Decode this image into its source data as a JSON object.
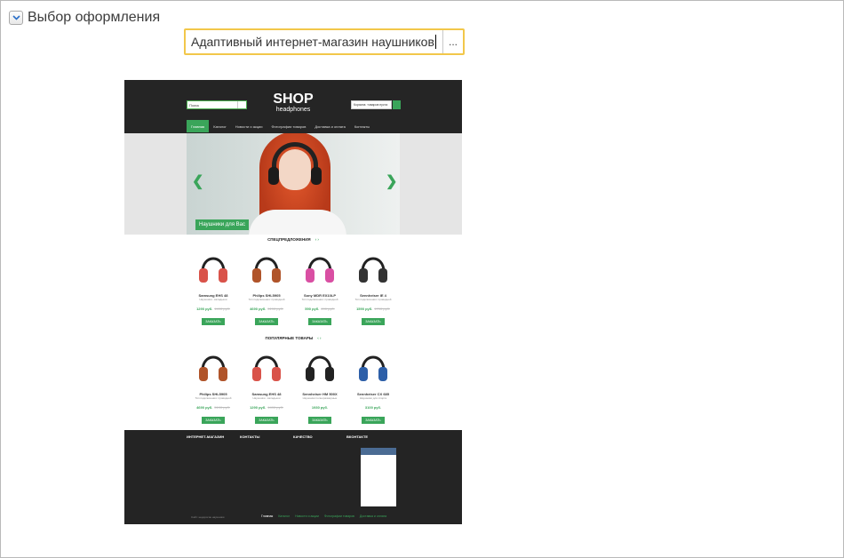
{
  "group": {
    "title": "Выбор оформления"
  },
  "field": {
    "value": "Адаптивный интернет-магазин наушников",
    "button_label": "..."
  },
  "preview": {
    "logo_line1": "SHOP",
    "logo_line2": "headphones",
    "search_placeholder": "Поиск",
    "cart_text": "Корзина: товаров пуста",
    "nav": [
      "Главная",
      "Каталог",
      "Новости и акции",
      "Фотографии товаров",
      "Доставка и оплата",
      "Контакты"
    ],
    "banner_tag": "Наушники для Вас",
    "section1_title": "СПЕЦПРЕДЛОЖЕНИЯ",
    "section2_title": "ПОПУЛЯРНЫЕ ТОВАРЫ",
    "products1": [
      {
        "name": "Samsung EHS 48",
        "desc": "Наушники - вкладыши",
        "price": "1290 руб.",
        "old": "1490 руб.",
        "buy": "ЗАКАЗАТЬ",
        "color": "#d9534a"
      },
      {
        "name": "Philips SHL5905",
        "desc": "Тип подключения: проводной",
        "price": "4690 руб.",
        "old": "5190 руб.",
        "buy": "ЗАКАЗАТЬ",
        "color": "#b0542a"
      },
      {
        "name": "Sony MDR EX10LP",
        "desc": "Тип подключения: проводной",
        "price": "590 руб.",
        "old": "690 руб.",
        "buy": "ЗАКАЗАТЬ",
        "color": "#d94fa3"
      },
      {
        "name": "Sennheiser IE 4",
        "desc": "Тип подключения: проводной",
        "price": "1590 руб.",
        "old": "1790 руб.",
        "buy": "ЗАКАЗАТЬ",
        "color": "#333333"
      }
    ],
    "products2": [
      {
        "name": "Philips SHL5905",
        "desc": "Тип подключения: проводной",
        "price": "4690 руб.",
        "old": "5190 руб.",
        "buy": "ЗАКАЗАТЬ",
        "color": "#b0542a"
      },
      {
        "name": "Samsung EHS 48",
        "desc": "Наушники - вкладыши",
        "price": "1290 руб.",
        "old": "1490 руб.",
        "buy": "ЗАКАЗАТЬ",
        "color": "#d9534a"
      },
      {
        "name": "Sennheiser HM 500X",
        "desc": "Наушники полноразмерные",
        "price": "1930 руб.",
        "old": "",
        "buy": "ЗАКАЗАТЬ",
        "color": "#222222"
      },
      {
        "name": "Sennheiser CX 685",
        "desc": "Наушники для спорта",
        "price": "3100 руб.",
        "old": "",
        "buy": "ЗАКАЗАТЬ",
        "color": "#2d5fa8"
      }
    ],
    "footer": {
      "col1": "ИНТЕРНЕТ-МАГАЗИН",
      "col2": "КОНТАКТЫ",
      "col3": "КАЧЕСТВО",
      "col4": "ВКОНТАКТЕ",
      "copyright": "Сайт: недорогие наушники",
      "nav": [
        "Главная",
        "Каталог",
        "Новости и акции",
        "Фотографии товаров",
        "Доставка и оплата"
      ]
    }
  }
}
